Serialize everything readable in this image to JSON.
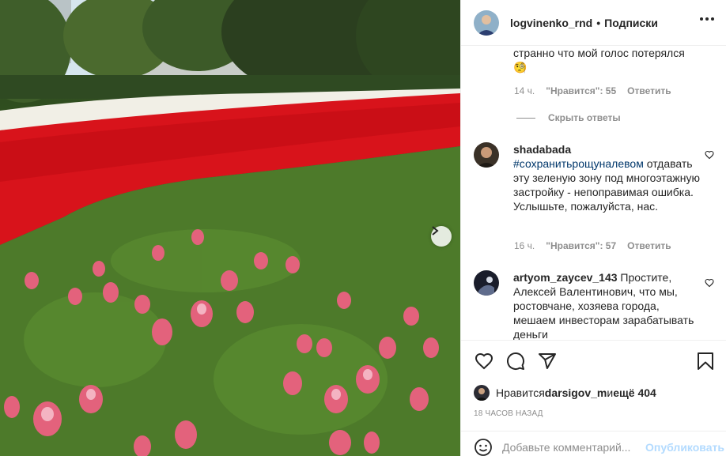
{
  "post": {
    "photo_alt": "tulips",
    "next_icon": "chevron-right-icon"
  },
  "header": {
    "username": "logvinenko_rnd",
    "separator": "•",
    "follow_label": "Подписки",
    "more_icon": "more-options-icon"
  },
  "comments": {
    "partial_first": {
      "text": "странно что мой голос потерялся",
      "emoji": "🧐",
      "time": "14 ч.",
      "likes": "\"Нравится\": 55",
      "reply": "Ответить"
    },
    "hide_replies": "Скрыть ответы",
    "items": [
      {
        "username": "shadabada",
        "hashtag": "#сохранитьрощуналевом",
        "text": " отдавать эту зеленую зону под многоэтажную застройку - непоправимая ошибка. Услышьте, пожалуйста, нас.",
        "time": "16 ч.",
        "likes": "\"Нравится\": 57",
        "reply": "Ответить"
      },
      {
        "username": "artyom_zaycev_143",
        "text": " Простите, Алексей Валентинович, что мы, ростовчане, хозяева города, мешаем инвесторам зарабатывать деньги"
      }
    ]
  },
  "actions": {
    "like_icon": "heart-icon",
    "comment_icon": "comment-icon",
    "share_icon": "share-icon",
    "save_icon": "bookmark-icon"
  },
  "likes": {
    "prefix": "Нравится ",
    "user": "darsigov_m",
    "middle": " и ",
    "others": "ещё 404"
  },
  "timestamp": "18 ЧАСОВ НАЗАД",
  "add_comment": {
    "placeholder": "Добавьте комментарий...",
    "post_label": "Опубликовать"
  }
}
